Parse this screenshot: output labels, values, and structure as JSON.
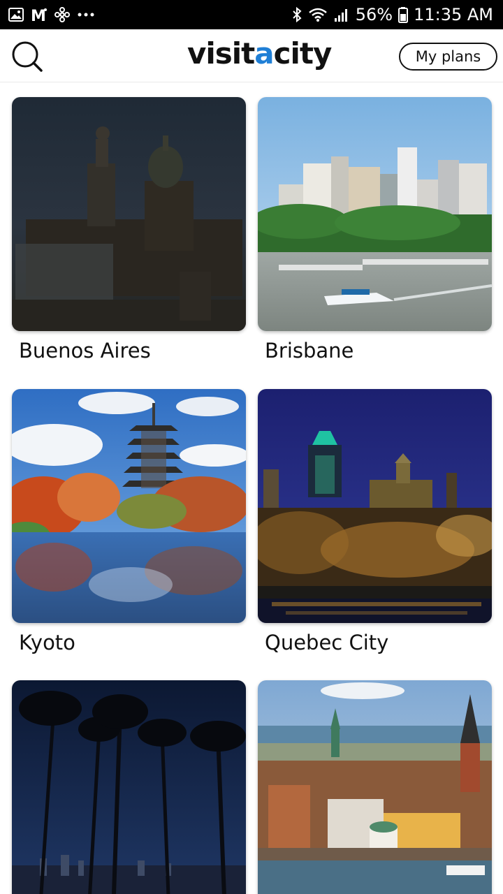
{
  "status_bar": {
    "left_icons": [
      "gallery-icon",
      "gmail-icon",
      "pinwheel-icon",
      "more-dots-icon"
    ],
    "right_icons": [
      "bluetooth-icon",
      "wifi-icon",
      "signal-icon",
      "battery-icon"
    ],
    "battery": "56%",
    "time": "11:35 AM"
  },
  "header": {
    "logo_part1": "visit",
    "logo_part2": "a",
    "logo_part3": "city",
    "my_plans_label": "My plans",
    "logo_accent_color": "#1f7fd6"
  },
  "cities": [
    {
      "name": "Buenos Aires",
      "image": "buenos-aires-photo"
    },
    {
      "name": "Brisbane",
      "image": "brisbane-photo"
    },
    {
      "name": "Kyoto",
      "image": "kyoto-photo"
    },
    {
      "name": "Quebec City",
      "image": "quebec-city-photo"
    },
    {
      "name": "",
      "image": "palm-trees-night-photo"
    },
    {
      "name": "",
      "image": "stockholm-photo"
    }
  ]
}
